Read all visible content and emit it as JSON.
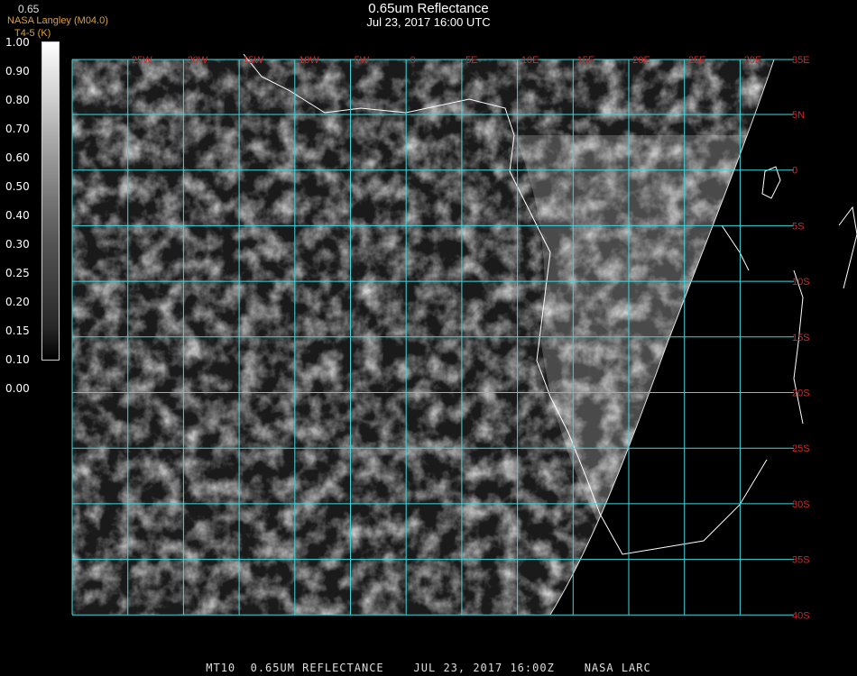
{
  "title": "0.65um Reflectance",
  "subtitle": "Jul 23, 2017 16:00 UTC",
  "header_left": {
    "band": "0.65",
    "org": "NASA Langley (M04.0)",
    "sub": "T4-5 (K)"
  },
  "colorbar": {
    "ticks": [
      "1.00",
      "0.90",
      "0.80",
      "0.70",
      "0.60",
      "0.50",
      "0.40",
      "0.30",
      "0.25",
      "0.20",
      "0.15",
      "0.10",
      "0.00"
    ]
  },
  "lon_labels": [
    "25W",
    "20W",
    "15W",
    "10W",
    "5W",
    "0",
    "5E",
    "10E",
    "15E",
    "20E",
    "25E",
    "30E",
    "35E"
  ],
  "lat_labels": [
    "5N",
    "0",
    "5S",
    "10S",
    "15S",
    "20S",
    "25S",
    "30S",
    "35S",
    "40S"
  ],
  "footer": "MT10  0.65UM REFLECTANCE    JUL 23, 2017 16:00Z    NASA LARC",
  "colors": {
    "grid": "#3fd7dc",
    "labels": "#d02a2a",
    "org_text": "#e0a030"
  }
}
